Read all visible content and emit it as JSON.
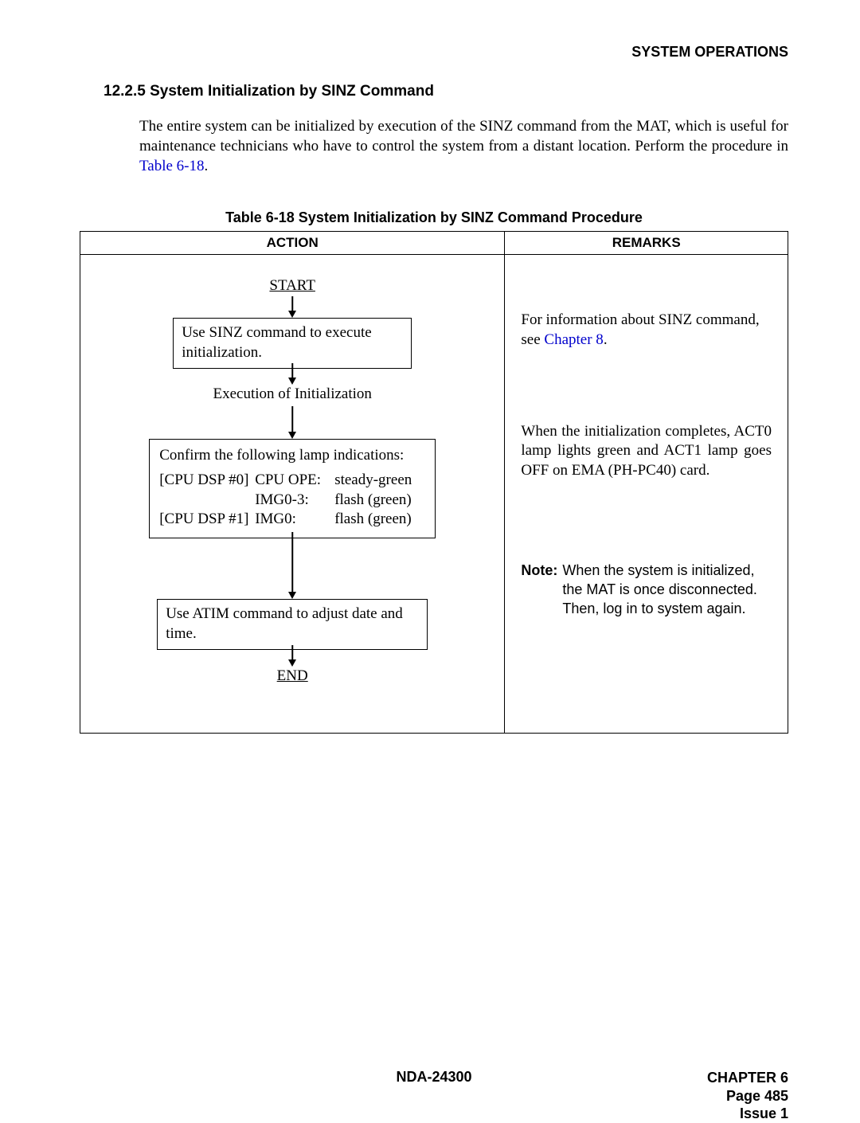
{
  "header": {
    "right": "SYSTEM OPERATIONS"
  },
  "section": {
    "number": "12.2.5",
    "title": "System Initialization by SINZ Command",
    "para_before_link": "The entire system can be initialized by execution of the SINZ command from the MAT, which is useful for maintenance technicians who have to control the system from a distant location. Perform the procedure in ",
    "link_text": "Table 6-18",
    "para_after_link": "."
  },
  "table": {
    "caption": "Table 6-18  System Initialization by SINZ Command Procedure",
    "headers": {
      "action": "ACTION",
      "remarks": "REMARKS"
    }
  },
  "flow": {
    "start": "START",
    "end": "END",
    "box1": "Use SINZ command to execute initialization.",
    "mid_text": "Execution of Initialization",
    "box2_header": "Confirm the following lamp indications:",
    "box2_rows": [
      {
        "c1": "[CPU DSP #0]",
        "c2": "CPU OPE:",
        "c3": "steady-green"
      },
      {
        "c1": "",
        "c2": "IMG0-3:",
        "c3": "flash (green)"
      },
      {
        "c1": "[CPU DSP #1]",
        "c2": "IMG0:",
        "c3": "flash (green)"
      }
    ],
    "box3": "Use ATIM command to adjust date and time."
  },
  "remarks": {
    "r1_before": "For information about SINZ command, see ",
    "r1_link": "Chapter 8",
    "r1_after": ".",
    "r2": "When the initialization completes, ACT0 lamp lights green and ACT1 lamp goes OFF on EMA (PH-PC40) card.",
    "note_label": "Note:",
    "note_body": "When the system is initialized, the MAT is once disconnected. Then, log in to system again."
  },
  "footer": {
    "center": "NDA-24300",
    "chapter": "CHAPTER 6",
    "page": "Page 485",
    "issue": "Issue 1"
  }
}
